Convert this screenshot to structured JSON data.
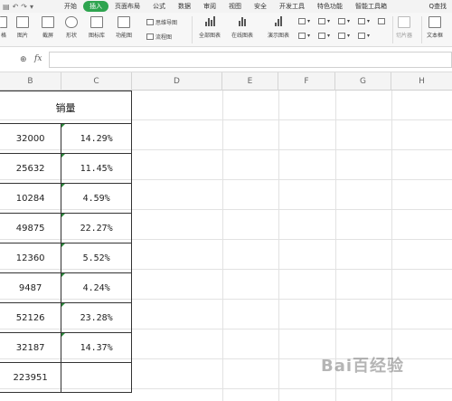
{
  "menubar": {
    "tabs": [
      "开始",
      "插入",
      "页面布局",
      "公式",
      "数据",
      "审阅",
      "视图",
      "安全",
      "开发工具",
      "特色功能",
      "智能工具箱"
    ],
    "active_tab": "插入",
    "search_label": "Q查找"
  },
  "ribbon": {
    "items": [
      "格",
      "图片",
      "截屏",
      "形状",
      "图标库",
      "功能图",
      "思维导图",
      "流程图",
      "全部图表",
      "在线图表",
      "演示图表",
      "切片器",
      "文本框"
    ]
  },
  "formula_bar": {
    "fx_label": "fx",
    "value": ""
  },
  "columns": [
    "B",
    "C",
    "D",
    "E",
    "F",
    "G",
    "H"
  ],
  "table": {
    "header": "销量",
    "rows": [
      {
        "value": "32000",
        "pct": "14.29%"
      },
      {
        "value": "25632",
        "pct": "11.45%"
      },
      {
        "value": "10284",
        "pct": "4.59%"
      },
      {
        "value": "49875",
        "pct": "22.27%"
      },
      {
        "value": "12360",
        "pct": "5.52%"
      },
      {
        "value": "9487",
        "pct": "4.24%"
      },
      {
        "value": "52126",
        "pct": "23.28%"
      },
      {
        "value": "32187",
        "pct": "14.37%"
      }
    ],
    "total": "223951"
  },
  "watermark": "Bai百经验",
  "colors": {
    "accent": "#2ea44f",
    "grid": "#e2e2e2",
    "indicator": "#2a8a3a"
  }
}
